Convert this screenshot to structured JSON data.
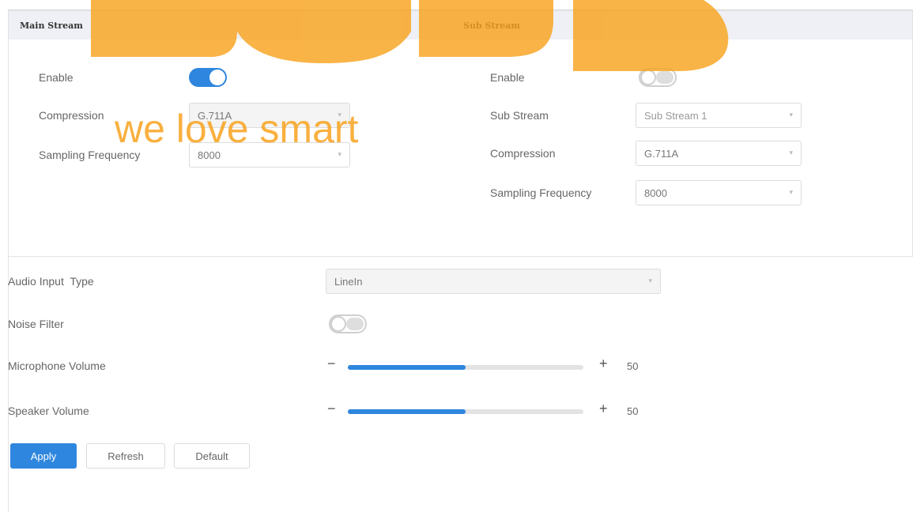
{
  "main_stream": {
    "title": "Main Stream",
    "enable_label": "Enable",
    "enabled": true,
    "compression_label": "Compression",
    "compression_value": "G.711A",
    "sampling_label": "Sampling Frequency",
    "sampling_value": "8000"
  },
  "sub_stream": {
    "title": "Sub Stream",
    "enable_label": "Enable",
    "enabled": false,
    "substream_label": "Sub Stream",
    "substream_value": "Sub Stream 1",
    "compression_label": "Compression",
    "compression_value": "G.711A",
    "sampling_label": "Sampling Frequency",
    "sampling_value": "8000"
  },
  "audio": {
    "input_type_label": "Audio Input  Type",
    "input_type_value": "LineIn",
    "noise_filter_label": "Noise Filter",
    "noise_filter_enabled": false,
    "mic_volume_label": "Microphone Volume",
    "mic_volume": "50",
    "speaker_volume_label": "Speaker Volume",
    "speaker_volume": "50",
    "minus_glyph": "−",
    "plus_glyph": "+"
  },
  "buttons": {
    "apply": "Apply",
    "refresh": "Refresh",
    "default": "Default"
  },
  "watermark": {
    "text": "we love smart",
    "color": "#f5a623"
  },
  "colors": {
    "accent": "#2e86de",
    "header_bg": "#eef0f5"
  }
}
